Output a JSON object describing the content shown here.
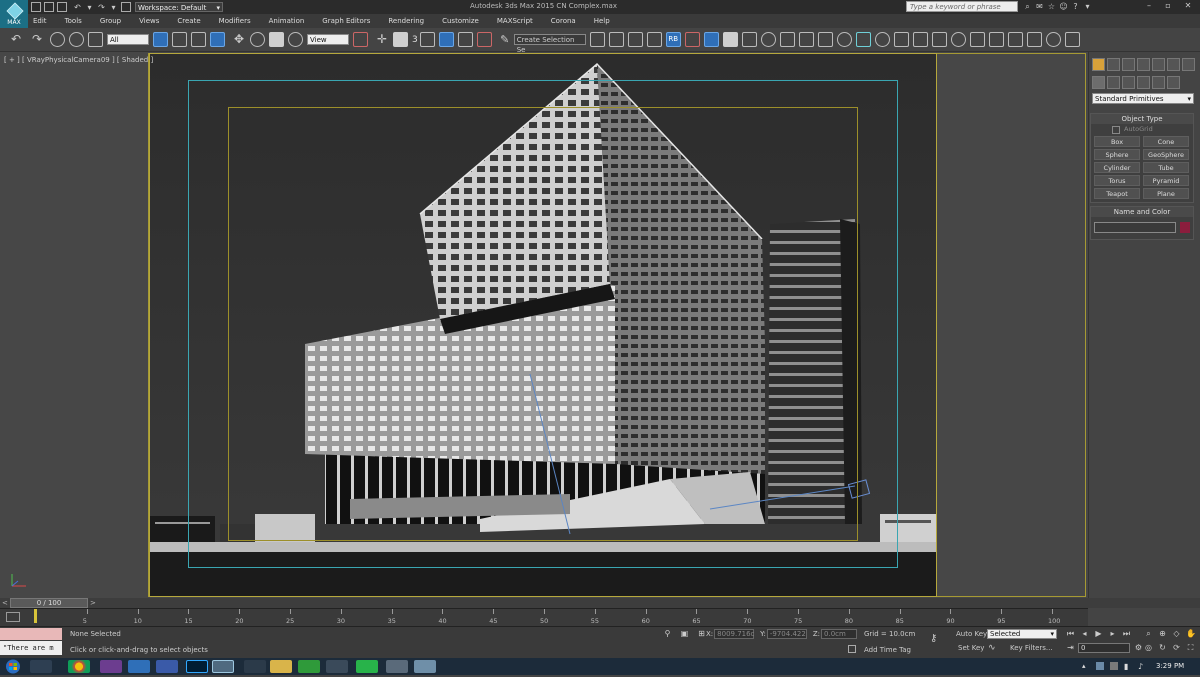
{
  "titlebar": {
    "logo_label": "MAX",
    "workspace": "Workspace: Default",
    "app_title": "Autodesk 3ds Max 2015    CN Complex.max",
    "search_placeholder": "Type a keyword or phrase"
  },
  "menu": [
    "Edit",
    "Tools",
    "Group",
    "Views",
    "Create",
    "Modifiers",
    "Animation",
    "Graph Editors",
    "Rendering",
    "Customize",
    "MAXScript",
    "Corona",
    "Help"
  ],
  "toolbar": {
    "filter": "All",
    "ref_coord": "View",
    "selection_set": "Create Selection Se",
    "mirror_label": "3",
    "render_label": "RB"
  },
  "viewport": {
    "label": "[ + ] [ VRayPhysicalCamera09 ] [ Shaded ]"
  },
  "command_panel": {
    "category": "Standard Primitives",
    "object_type_title": "Object Type",
    "autogrid": "AutoGrid",
    "primitives": [
      "Box",
      "Cone",
      "Sphere",
      "GeoSphere",
      "Cylinder",
      "Tube",
      "Torus",
      "Pyramid",
      "Teapot",
      "Plane"
    ],
    "name_color_title": "Name and Color",
    "object_color": "#8b1d3d"
  },
  "timeline": {
    "slider_label": "0 / 100",
    "ticks": [
      "5",
      "10",
      "15",
      "20",
      "25",
      "30",
      "35",
      "40",
      "45",
      "50",
      "55",
      "60",
      "65",
      "70",
      "75",
      "80",
      "85",
      "90",
      "95",
      "100"
    ]
  },
  "status": {
    "selection": "None Selected",
    "prompt": "Click or click-and-drag to select objects",
    "script_output": "\"There are m",
    "x_label": "X:",
    "x_value": "8009.716c",
    "y_label": "Y:",
    "y_value": "-9704.422",
    "z_label": "Z:",
    "z_value": "0.0cm",
    "grid": "Grid = 10.0cm",
    "add_time_tag": "Add Time Tag",
    "auto_key": "Auto Key",
    "auto_key_value": "Selected",
    "set_key": "Set Key",
    "key_filters": "Key Filters...",
    "frame": "0"
  },
  "taskbar": {
    "clock": "3:29 PM"
  }
}
